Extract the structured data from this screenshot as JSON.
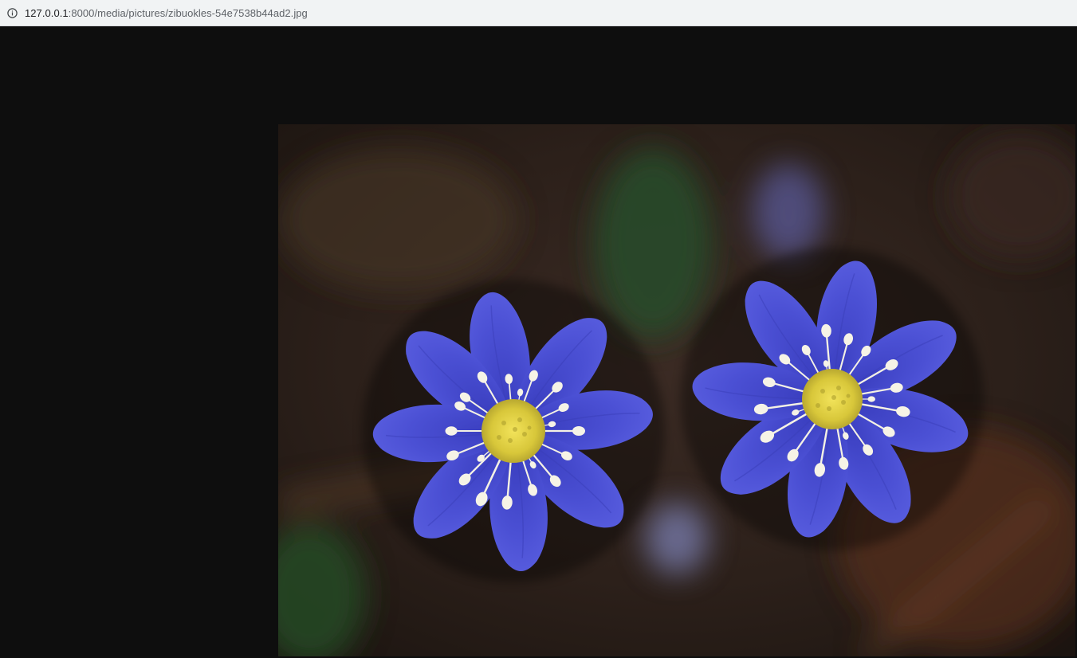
{
  "address_bar": {
    "url_host": "127.0.0.1",
    "url_rest": ":8000/media/pictures/zibuokles-54e7538b44ad2.jpg",
    "icon": "info-icon"
  },
  "viewer": {
    "background_color": "#0e0e0e",
    "image": {
      "description_icon": "photo-two-blue-hepatica-flowers",
      "petal_color": "#4a4fd0",
      "center_color": "#e8d84a",
      "stamen_color": "#f4f0e0",
      "background_tone": "#3a2a22"
    }
  }
}
